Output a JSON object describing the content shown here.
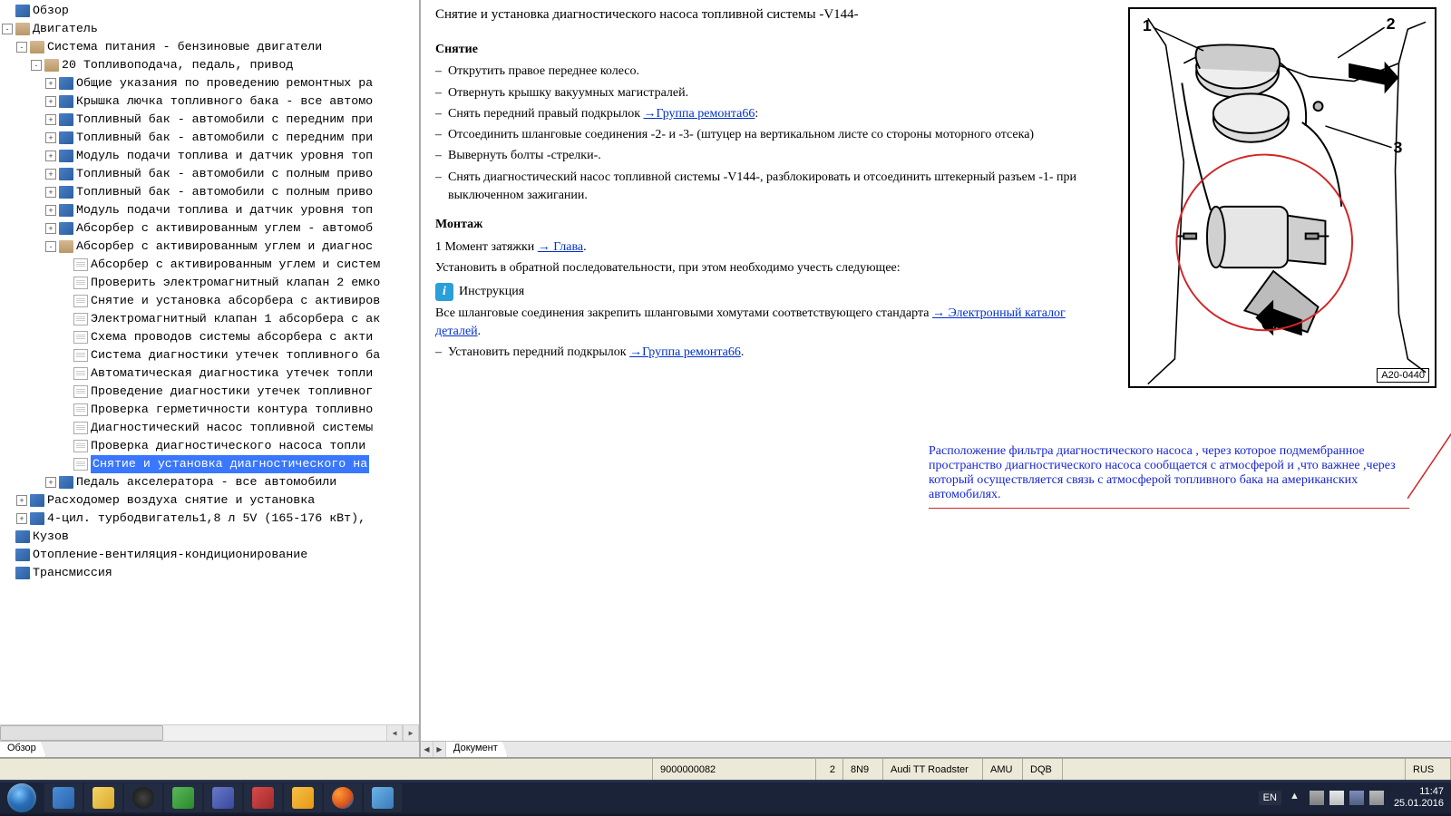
{
  "tree": {
    "items": [
      {
        "indent": 0,
        "exp": null,
        "icon": "book-closed",
        "label": "Обзор"
      },
      {
        "indent": 0,
        "exp": "-",
        "icon": "book-open",
        "label": "Двигатель"
      },
      {
        "indent": 1,
        "exp": "-",
        "icon": "book-open",
        "label": "Система питания - бензиновые двигатели"
      },
      {
        "indent": 2,
        "exp": "-",
        "icon": "book-open",
        "label": "20 Топливоподача, педаль, привод"
      },
      {
        "indent": 3,
        "exp": "+",
        "icon": "book-closed",
        "label": "Общие указания по проведению ремонтных ра"
      },
      {
        "indent": 3,
        "exp": "+",
        "icon": "book-closed",
        "label": "Крышка лючка топливного бака - все автомо"
      },
      {
        "indent": 3,
        "exp": "+",
        "icon": "book-closed",
        "label": "Топливный бак - автомобили с передним при"
      },
      {
        "indent": 3,
        "exp": "+",
        "icon": "book-closed",
        "label": "Топливный бак - автомобили с передним при"
      },
      {
        "indent": 3,
        "exp": "+",
        "icon": "book-closed",
        "label": "Модуль подачи топлива и датчик уровня топ"
      },
      {
        "indent": 3,
        "exp": "+",
        "icon": "book-closed",
        "label": "Топливный бак - автомобили с полным приво"
      },
      {
        "indent": 3,
        "exp": "+",
        "icon": "book-closed",
        "label": "Топливный бак - автомобили с полным приво"
      },
      {
        "indent": 3,
        "exp": "+",
        "icon": "book-closed",
        "label": "Модуль подачи топлива и датчик уровня топ"
      },
      {
        "indent": 3,
        "exp": "+",
        "icon": "book-closed",
        "label": "Абсорбер с активированным углем - автомоб"
      },
      {
        "indent": 3,
        "exp": "-",
        "icon": "book-open",
        "label": "Абсорбер с активированным углем и диагнос"
      },
      {
        "indent": 4,
        "exp": null,
        "icon": "page",
        "label": "Абсорбер с активированным углем и систем"
      },
      {
        "indent": 4,
        "exp": null,
        "icon": "page",
        "label": "Проверить электромагнитный клапан 2 емко"
      },
      {
        "indent": 4,
        "exp": null,
        "icon": "page",
        "label": "Снятие и установка абсорбера с активиров"
      },
      {
        "indent": 4,
        "exp": null,
        "icon": "page",
        "label": "Электромагнитный клапан 1 абсорбера с ак"
      },
      {
        "indent": 4,
        "exp": null,
        "icon": "page",
        "label": "Схема проводов системы абсорбера с акти"
      },
      {
        "indent": 4,
        "exp": null,
        "icon": "page",
        "label": "Система диагностики утечек топливного ба"
      },
      {
        "indent": 4,
        "exp": null,
        "icon": "page",
        "label": "Автоматическая диагностика утечек топли"
      },
      {
        "indent": 4,
        "exp": null,
        "icon": "page",
        "label": "Проведение диагностики утечек топливног"
      },
      {
        "indent": 4,
        "exp": null,
        "icon": "page",
        "label": "Проверка герметичности контура топливно"
      },
      {
        "indent": 4,
        "exp": null,
        "icon": "page",
        "label": "Диагностический насос топливной системы"
      },
      {
        "indent": 4,
        "exp": null,
        "icon": "page",
        "label": "Проверка  диагностического насоса топли"
      },
      {
        "indent": 4,
        "exp": null,
        "icon": "page",
        "label": "Снятие и установка  диагностического на",
        "selected": true
      },
      {
        "indent": 3,
        "exp": "+",
        "icon": "book-closed",
        "label": "Педаль акселератора - все автомобили"
      },
      {
        "indent": 1,
        "exp": "+",
        "icon": "book-closed",
        "label": "Расходомер воздуха снятие и установка"
      },
      {
        "indent": 1,
        "exp": "+",
        "icon": "book-closed",
        "label": "4-цил. турбодвигатель1,8 л 5V (165-176 кВт),"
      },
      {
        "indent": 0,
        "exp": null,
        "icon": "book-closed",
        "label": "Кузов"
      },
      {
        "indent": 0,
        "exp": null,
        "icon": "book-closed",
        "label": "Отопление-вентиляция-кондиционирование"
      },
      {
        "indent": 0,
        "exp": null,
        "icon": "book-closed",
        "label": "Трансмиссия"
      }
    ]
  },
  "left_tab": "Обзор",
  "right_tab": "Документ",
  "document": {
    "title": "Снятие и установка диагностического насоса топливной системы -V144-",
    "section_removal": "Снятие",
    "step1": "Открутить правое переднее колесо.",
    "step2": "Отвернуть крышку вакуумных магистралей.",
    "step3_a": "Снять передний правый подкрылок ",
    "step3_link": "→Группа ремонта66",
    "step3_b": ":",
    "step4": "Отсоединить шланговые соединения -2- и -3- (штуцер на вертикальном листе со стороны моторного отсека)",
    "step5": "Вывернуть болты -стрелки-.",
    "step6": "Снять диагностический насос топливной системы -V144-, разблокировать и отсоединить штекерный разъем -1- при выключенном зажигании.",
    "section_install": "Монтаж",
    "install1_a": "1 Момент затяжки ",
    "install1_link": "→ Глава",
    "install1_b": ".",
    "install2": "Установить в обратной последовательности, при этом необходимо учесть следующее:",
    "instruction_label": "Инструкция",
    "instruction_a": "Все шланговые соединения закрепить шланговыми хомутами соответствующего стандарта ",
    "instruction_link": "→ Электронный каталог деталей",
    "instruction_b": ".",
    "install3_a": "Установить передний подкрылок ",
    "install3_link": "→Группа ремонта66",
    "install3_b": ".",
    "fig_label": "A20-0440",
    "fig_marker1": "1",
    "fig_marker2": "2",
    "fig_marker3": "3",
    "annotation": "Расположение  фильтра диагностического насоса  , через  которое подмембранное  пространство диагностического насоса  сообщается  с атмосферой и  ,что важнее ,через который осуществляется  связь с атмосферой топливного бака  на американских автомобилях."
  },
  "statusbar": {
    "id": "9000000082",
    "col2": "2",
    "col3": "8N9",
    "model": "Audi TT Roadster",
    "engine": "AMU",
    "trans": "DQB",
    "lang": "RUS"
  },
  "taskbar": {
    "lang": "EN",
    "time": "11:47",
    "date": "25.01.2016"
  }
}
